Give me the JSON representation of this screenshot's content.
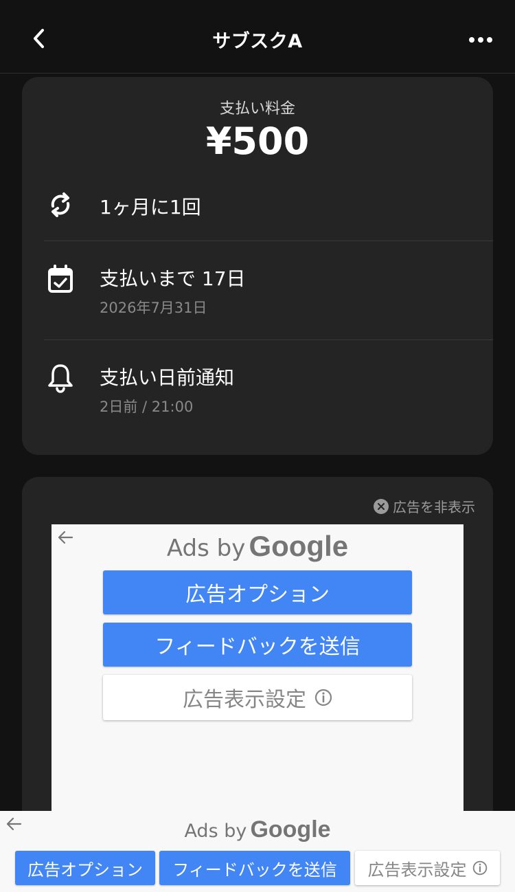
{
  "header": {
    "title": "サブスクA",
    "back_icon": "chevron-left-icon",
    "more_icon": "more-horizontal-icon"
  },
  "payment": {
    "label": "支払い料金",
    "amount": "¥500"
  },
  "rows": [
    {
      "icon": "repeat-icon",
      "main": "1ヶ月に1回"
    },
    {
      "icon": "calendar-check-icon",
      "main": "支払いまで 17日",
      "sub": "2026年7月31日"
    },
    {
      "icon": "bell-icon",
      "main": "支払い日前通知",
      "sub": "2日前 / 21:00"
    }
  ],
  "ad_card": {
    "hide_label": "広告を非表示",
    "ads_by": "Ads by",
    "google": "Google",
    "options_label": "広告オプション",
    "feedback_label": "フィードバックを送信",
    "settings_label": "広告表示設定"
  },
  "bottom_ad": {
    "ads_by": "Ads by",
    "google": "Google",
    "options_label": "広告オプション",
    "feedback_label": "フィードバックを送信",
    "settings_label": "広告表示設定"
  },
  "colors": {
    "background": "#121212",
    "card": "#242424",
    "ad_blue": "#4285f4",
    "muted_text": "#8a8a8a"
  }
}
